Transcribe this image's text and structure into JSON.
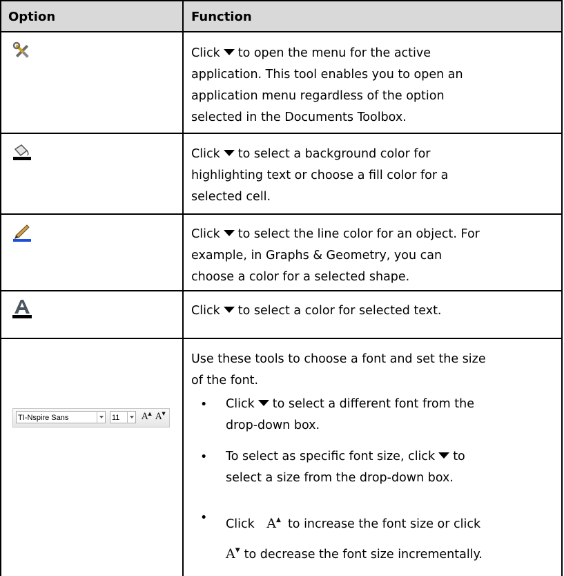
{
  "header": {
    "option_label": "Option",
    "function_label": "Function"
  },
  "rows": [
    {
      "icon": "tools-icon",
      "lines": [
        "Click",
        "to open the menu for the active",
        "application. This tool enables you to open an",
        "application menu regardless of the option",
        "selected in the Documents Toolbox."
      ]
    },
    {
      "icon": "fill-color-icon",
      "lines": [
        "Click",
        "to select a background color for",
        "highlighting text or choose a fill color for a",
        "selected cell."
      ]
    },
    {
      "icon": "line-color-icon",
      "lines": [
        "Click",
        "to select the line color for an object. For",
        "example, in Graphs & Geometry, you can",
        "choose a color for a selected shape."
      ]
    },
    {
      "icon": "text-color-icon",
      "lines": [
        "Click",
        "to select a color for selected text."
      ]
    },
    {
      "icon": "font-toolbar-icon",
      "intro": [
        "Use these tools to choose a font and set the size",
        "of the font."
      ],
      "bullets": [
        {
          "a": "Click",
          "b": "to select a different font from the",
          "c": "drop-down box."
        },
        {
          "a": "To select as specific font size, click",
          "b": "to",
          "c": "select a size from the drop-down box."
        },
        {
          "a": "Click",
          "b": "to increase the font size or click",
          "c": "to decrease the font size incrementally."
        }
      ],
      "bullet_char": "•",
      "toolbar": {
        "font_name": "TI-Nspire Sans",
        "font_size": "11",
        "increase_glyph": "A",
        "decrease_glyph": "A"
      }
    }
  ],
  "colors": {
    "header_bg": "#d9d9d9",
    "line_blue": "#1f4fd8",
    "grid": "#000000"
  }
}
